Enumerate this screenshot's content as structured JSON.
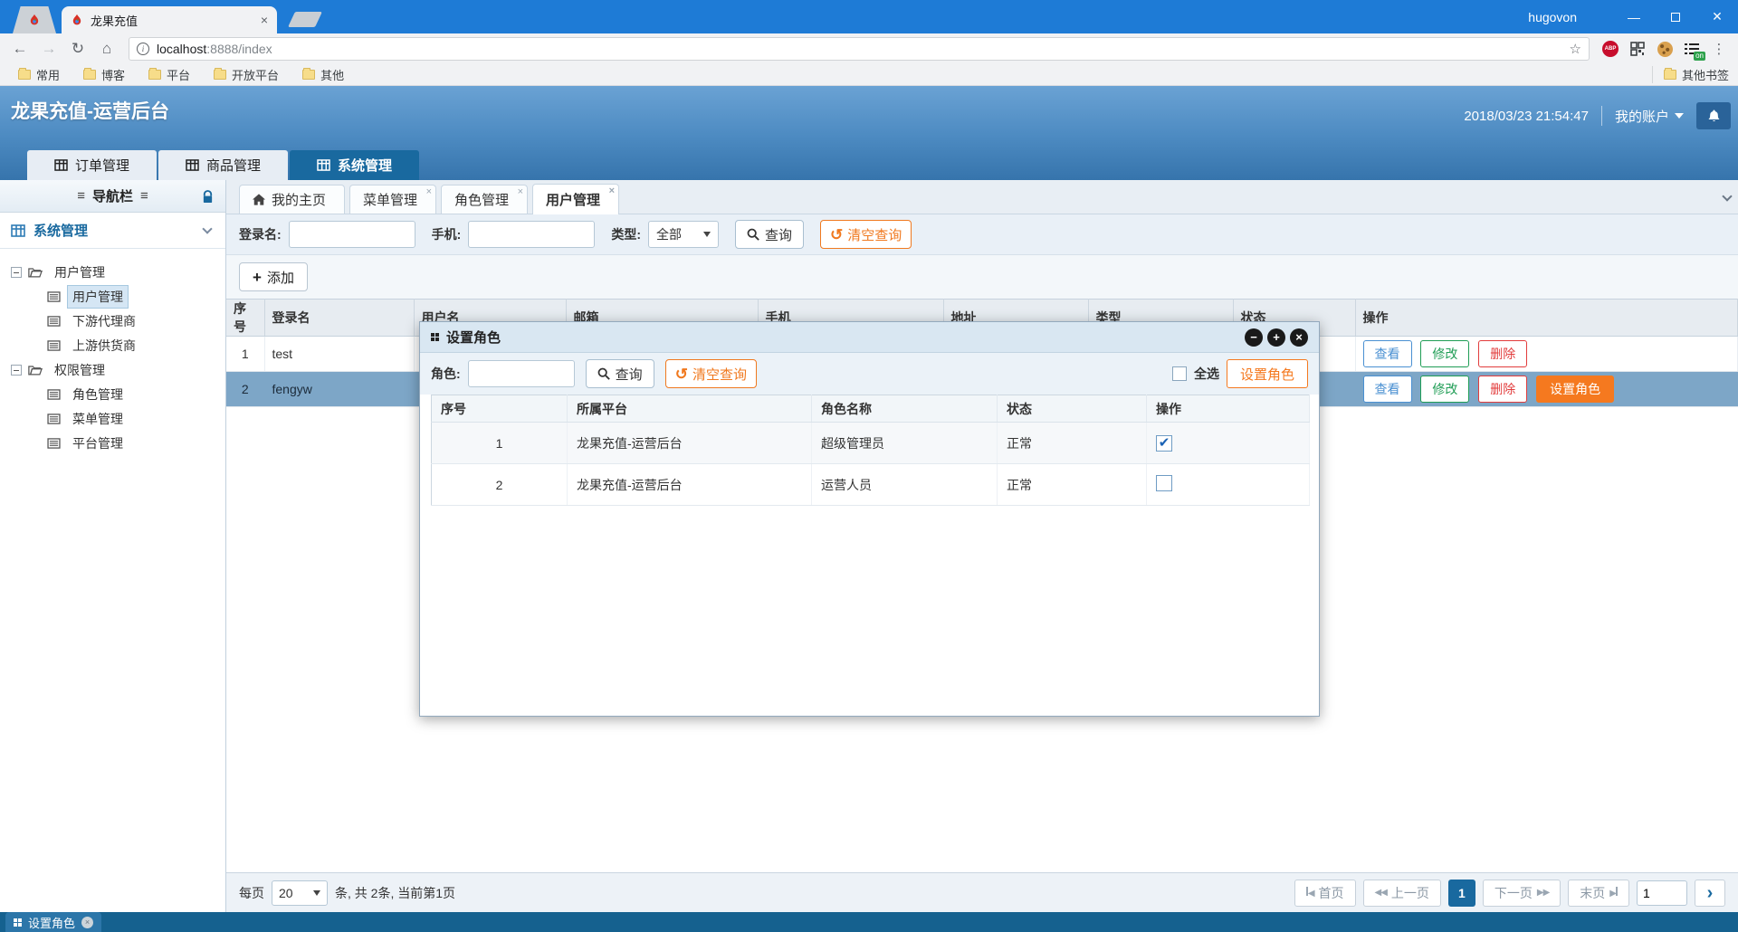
{
  "browser": {
    "active_tab_title": "龙果充值",
    "username": "hugovon",
    "url_host": "localhost",
    "url_rest": ":8888/index",
    "bookmarks": [
      "常用",
      "博客",
      "平台",
      "开放平台",
      "其他"
    ],
    "other_bookmarks_label": "其他书签",
    "abp_badge": "ABP",
    "on_badge": "on"
  },
  "header": {
    "title": "龙果充值-运营后台",
    "datetime": "2018/03/23 21:54:47",
    "account_label": "我的账户",
    "nav_tabs": [
      {
        "label": "订单管理",
        "active": false
      },
      {
        "label": "商品管理",
        "active": false
      },
      {
        "label": "系统管理",
        "active": true
      }
    ]
  },
  "sidebar": {
    "title": "导航栏",
    "section_label": "系统管理",
    "tree": [
      {
        "label": "用户管理",
        "type": "folder"
      },
      {
        "label": "用户管理",
        "type": "leaf",
        "selected": true
      },
      {
        "label": "下游代理商",
        "type": "leaf"
      },
      {
        "label": "上游供货商",
        "type": "leaf"
      },
      {
        "label": "权限管理",
        "type": "folder"
      },
      {
        "label": "角色管理",
        "type": "leaf"
      },
      {
        "label": "菜单管理",
        "type": "leaf"
      },
      {
        "label": "平台管理",
        "type": "leaf"
      }
    ]
  },
  "content": {
    "tabs": [
      {
        "label": "我的主页",
        "icon": "home",
        "closable": false,
        "active": false
      },
      {
        "label": "菜单管理",
        "closable": true,
        "active": false
      },
      {
        "label": "角色管理",
        "closable": true,
        "active": false
      },
      {
        "label": "用户管理",
        "closable": true,
        "active": true
      }
    ],
    "search": {
      "login_label": "登录名:",
      "phone_label": "手机:",
      "type_label": "类型:",
      "type_value": "全部",
      "query_label": "查询",
      "clear_label": "清空查询"
    },
    "add_label": "添加",
    "table": {
      "headers": [
        "序号",
        "登录名",
        "用户名",
        "邮箱",
        "手机",
        "地址",
        "类型",
        "状态",
        "操作"
      ],
      "rows": [
        {
          "seq": "1",
          "login": "test",
          "selected": false,
          "actions": {
            "view": "查看",
            "edit": "修改",
            "del": "删除"
          }
        },
        {
          "seq": "2",
          "login": "fengyw",
          "selected": true,
          "actions": {
            "view": "查看",
            "edit": "修改",
            "del": "删除",
            "set_role": "设置角色"
          }
        }
      ]
    },
    "pagination": {
      "per_page_label": "每页",
      "per_page_value": "20",
      "summary": "条, 共 2条, 当前第1页",
      "first_label": "首页",
      "prev_label": "上一页",
      "current_page": "1",
      "next_label": "下一页",
      "last_label": "末页",
      "goto_value": "1"
    }
  },
  "modal": {
    "title": "设置角色",
    "role_label": "角色:",
    "query_label": "查询",
    "clear_label": "清空查询",
    "select_all_label": "全选",
    "set_role_label": "设置角色",
    "table": {
      "headers": [
        "序号",
        "所属平台",
        "角色名称",
        "状态",
        "操作"
      ],
      "rows": [
        {
          "seq": "1",
          "platform": "龙果充值-运营后台",
          "role": "超级管理员",
          "status": "正常",
          "checked": true
        },
        {
          "seq": "2",
          "platform": "龙果充值-运营后台",
          "role": "运营人员",
          "status": "正常",
          "checked": false
        }
      ]
    }
  },
  "taskbar": {
    "item_label": "设置角色"
  },
  "colors": {
    "chrome_blue": "#1e7bd6",
    "header_gradient_top": "#6aa2d4",
    "header_gradient_bottom": "#3674ac",
    "active_tab_blue": "#19699f",
    "accent_orange": "#f5791f",
    "selected_row_blue": "#7da6c7",
    "link_blue": "#4a90d2",
    "green": "#1f9d55",
    "red": "#e23c3c",
    "taskbar_blue": "#15618f"
  }
}
